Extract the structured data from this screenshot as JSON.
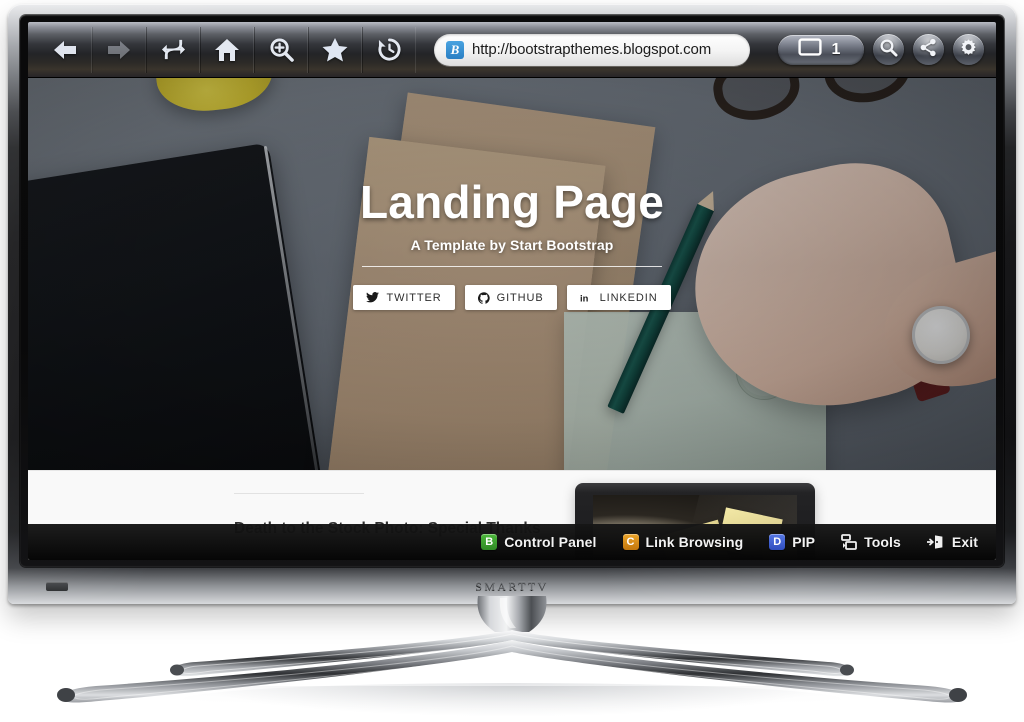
{
  "browser": {
    "toolbar_buttons": [
      {
        "name": "back",
        "icon": "arrow-left-icon",
        "disabled": false
      },
      {
        "name": "forward",
        "icon": "arrow-right-icon",
        "disabled": true
      },
      {
        "name": "refresh",
        "icon": "refresh-icon",
        "disabled": false
      },
      {
        "name": "home",
        "icon": "home-icon",
        "disabled": false
      },
      {
        "name": "zoom",
        "icon": "magnifier-plus-icon",
        "disabled": false
      },
      {
        "name": "bookmark",
        "icon": "star-icon",
        "disabled": false
      },
      {
        "name": "history",
        "icon": "history-clock-icon",
        "disabled": false
      }
    ],
    "url": "http://bootstrapthemes.blogspot.com",
    "favicon_letter": "B",
    "tab_count": "1",
    "right_buttons": [
      {
        "name": "search",
        "icon": "search-icon"
      },
      {
        "name": "share",
        "icon": "share-icon"
      },
      {
        "name": "settings",
        "icon": "gear-icon"
      }
    ]
  },
  "page": {
    "hero": {
      "title": "Landing Page",
      "subtitle": "A Template by Start Bootstrap",
      "social": [
        {
          "label": "TWITTER",
          "icon": "twitter-icon"
        },
        {
          "label": "GITHUB",
          "icon": "github-icon"
        },
        {
          "label": "LINKEDIN",
          "icon": "linkedin-icon"
        }
      ]
    },
    "content": {
      "heading": "Death to the Stock Photo: Special Thanks"
    }
  },
  "smarttv_menu": [
    {
      "key": "B",
      "label": "Control Panel",
      "key_color": "#3a9b2e",
      "glyph": null
    },
    {
      "key": "C",
      "label": "Link Browsing",
      "key_color": "#d78a16",
      "glyph": null
    },
    {
      "key": "D",
      "label": "PIP",
      "key_color": "#3a5fd0",
      "glyph": null
    },
    {
      "key": null,
      "label": "Tools",
      "key_color": null,
      "glyph": "tools-icon"
    },
    {
      "key": null,
      "label": "Exit",
      "key_color": null,
      "glyph": "exit-icon"
    }
  ],
  "device": {
    "brand": "SMARTTV"
  },
  "colors": {
    "accent_green": "#3a9b2e",
    "accent_orange": "#d78a16",
    "accent_blue": "#3a5fd0",
    "favicon_blue": "#2a7fc4",
    "screen_bg": "#f8f8f8"
  }
}
